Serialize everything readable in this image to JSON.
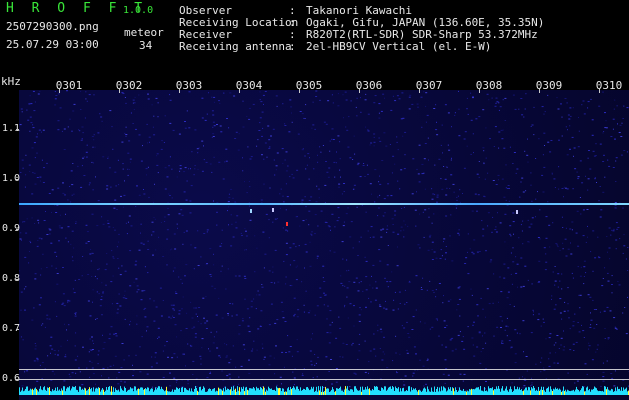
{
  "header": {
    "app_name": "H R O F F T",
    "app_version": "1.0.0",
    "file_name": "2507290300.png",
    "date_time": "25.07.29 03:00",
    "mode_label": "meteor",
    "count_value": "34",
    "info": [
      {
        "key": "Observer",
        "value": "Takanori Kawachi"
      },
      {
        "key": "Receiving Location",
        "value": "Ogaki, Gifu, JAPAN (136.60E, 35.35N)"
      },
      {
        "key": "Receiver",
        "value": "R820T2(RTL-SDR) SDR-Sharp 53.372MHz"
      },
      {
        "key": "Receiving antenna",
        "value": "2el-HB9CV Vertical (el. E-W)"
      }
    ]
  },
  "plot": {
    "y_unit": "kHz",
    "y_ticks": [
      "1.1",
      "1.0",
      "0.9",
      "0.8",
      "0.7",
      "0.6"
    ],
    "x_ticks": [
      "0301",
      "0302",
      "0303",
      "0304",
      "0305",
      "0306",
      "0307",
      "0308",
      "0309",
      "0310"
    ],
    "colors": {
      "background": "#06063a",
      "signal": "#7fd6ff",
      "meteor_echo": "#ff3030",
      "level_cyan": "#22e0ff",
      "level_yellow": "#ffff33",
      "text": "#e8e8e8",
      "app_name": "#39e639"
    },
    "signal_freq_khz": 0.95,
    "meteor_echo_freq_khz": 0.935
  }
}
